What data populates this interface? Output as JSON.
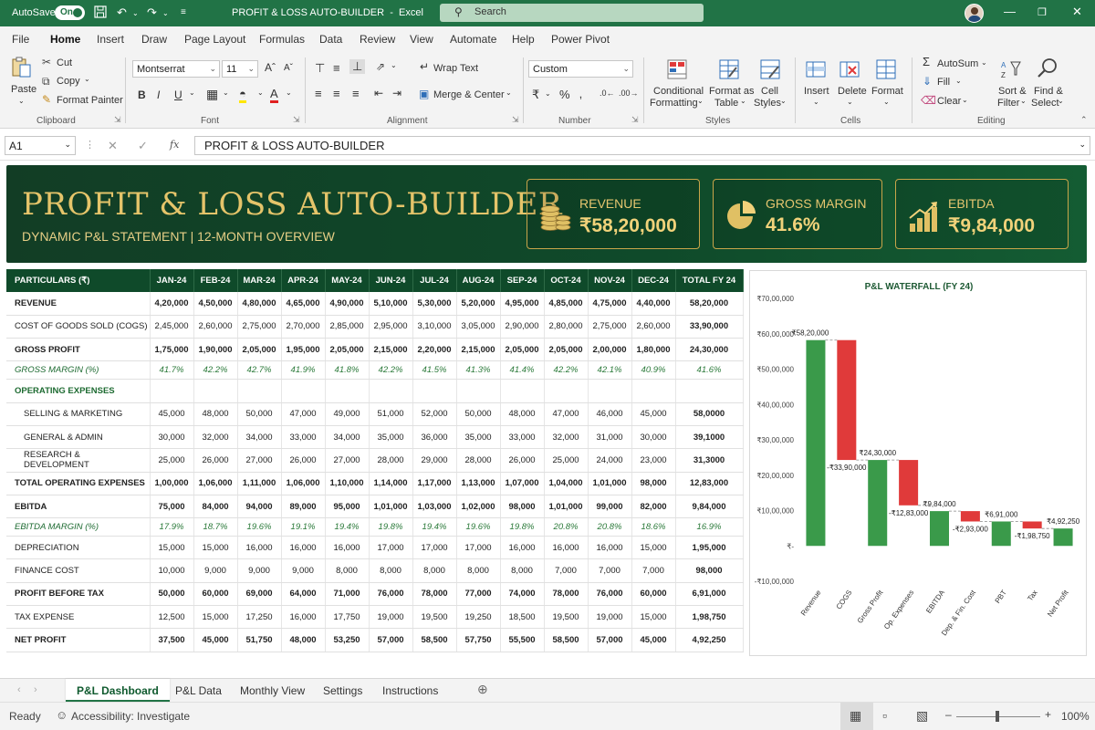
{
  "titlebar": {
    "autosave_label": "AutoSave",
    "autosave_state": "On",
    "doc_title": "PROFIT & LOSS AUTO-BUILDER",
    "separator": "-",
    "app_name": "Excel",
    "search_placeholder": "Search"
  },
  "menu": [
    "File",
    "Home",
    "Insert",
    "Draw",
    "Page Layout",
    "Formulas",
    "Data",
    "Review",
    "View",
    "Automate",
    "Help",
    "Power Pivot"
  ],
  "ribbon": {
    "paste": "Paste",
    "cut": "Cut",
    "copy": "Copy",
    "format_painter": "Format Painter",
    "font_name": "Montserrat",
    "font_size": "11",
    "wrap_text": "Wrap Text",
    "merge_center": "Merge & Center",
    "number_format": "Custom",
    "conditional": "Conditional",
    "formatting": "Formatting",
    "format_as": "Format as",
    "table": "Table",
    "cell": "Cell",
    "styles_btn": "Styles",
    "insert": "Insert",
    "delete": "Delete",
    "format": "Format",
    "autosum": "AutoSum",
    "fill": "Fill",
    "clear": "Clear",
    "sort_filter_1": "Sort &",
    "sort_filter_2": "Filter",
    "find_select_1": "Find &",
    "find_select_2": "Select",
    "groups": {
      "clipboard": "Clipboard",
      "font": "Font",
      "alignment": "Alignment",
      "number": "Number",
      "styles": "Styles",
      "cells": "Cells",
      "editing": "Editing"
    }
  },
  "formula": {
    "cell_ref": "A1",
    "content": "PROFIT & LOSS AUTO-BUILDER"
  },
  "banner": {
    "title": "PROFIT & LOSS AUTO-BUILDER",
    "subtitle": "DYNAMIC P&L STATEMENT  |  12-MONTH OVERVIEW",
    "kpis": [
      {
        "label": "REVENUE",
        "value": "₹58,20,000"
      },
      {
        "label": "GROSS MARGIN",
        "value": "41.6%"
      },
      {
        "label": "EBITDA",
        "value": "₹9,84,000"
      }
    ]
  },
  "table": {
    "headers": [
      "PARTICULARS (₹)",
      "JAN-24",
      "FEB-24",
      "MAR-24",
      "APR-24",
      "MAY-24",
      "JUN-24",
      "JUL-24",
      "AUG-24",
      "SEP-24",
      "OCT-24",
      "NOV-24",
      "DEC-24",
      "TOTAL FY 24"
    ],
    "rows": [
      {
        "style": "bold",
        "cells": [
          "REVENUE",
          "4,20,000",
          "4,50,000",
          "4,80,000",
          "4,65,000",
          "4,90,000",
          "5,10,000",
          "5,30,000",
          "5,20,000",
          "4,95,000",
          "4,85,000",
          "4,75,000",
          "4,40,000",
          "58,20,000"
        ]
      },
      {
        "style": "plain",
        "cells": [
          "COST OF GOODS SOLD (COGS)",
          "2,45,000",
          "2,60,000",
          "2,75,000",
          "2,70,000",
          "2,85,000",
          "2,95,000",
          "3,10,000",
          "3,05,000",
          "2,90,000",
          "2,80,000",
          "2,75,000",
          "2,60,000",
          "33,90,000"
        ]
      },
      {
        "style": "bold",
        "cells": [
          "GROSS PROFIT",
          "1,75,000",
          "1,90,000",
          "2,05,000",
          "1,95,000",
          "2,05,000",
          "2,15,000",
          "2,20,000",
          "2,15,000",
          "2,05,000",
          "2,05,000",
          "2,00,000",
          "1,80,000",
          "24,30,000"
        ]
      },
      {
        "style": "pct",
        "cells": [
          "GROSS MARGIN (%)",
          "41.7%",
          "42.2%",
          "42.7%",
          "41.9%",
          "41.8%",
          "42.2%",
          "41.5%",
          "41.3%",
          "41.4%",
          "42.2%",
          "42.1%",
          "40.9%",
          "41.6%"
        ]
      },
      {
        "style": "section",
        "cells": [
          "OPERATING EXPENSES",
          "",
          "",
          "",
          "",
          "",
          "",
          "",
          "",
          "",
          "",
          "",
          "",
          ""
        ]
      },
      {
        "style": "indent",
        "cells": [
          "SELLING & MARKETING",
          "45,000",
          "48,000",
          "50,000",
          "47,000",
          "49,000",
          "51,000",
          "52,000",
          "50,000",
          "48,000",
          "47,000",
          "46,000",
          "45,000",
          "58,0000"
        ]
      },
      {
        "style": "indent",
        "cells": [
          "GENERAL & ADMIN",
          "30,000",
          "32,000",
          "34,000",
          "33,000",
          "34,000",
          "35,000",
          "36,000",
          "35,000",
          "33,000",
          "32,000",
          "31,000",
          "30,000",
          "39,1000"
        ]
      },
      {
        "style": "indent",
        "cells": [
          "RESEARCH & DEVELOPMENT",
          "25,000",
          "26,000",
          "27,000",
          "26,000",
          "27,000",
          "28,000",
          "29,000",
          "28,000",
          "26,000",
          "25,000",
          "24,000",
          "23,000",
          "31,3000"
        ]
      },
      {
        "style": "bold",
        "cells": [
          "TOTAL OPERATING EXPENSES",
          "1,00,000",
          "1,06,000",
          "1,11,000",
          "1,06,000",
          "1,10,000",
          "1,14,000",
          "1,17,000",
          "1,13,000",
          "1,07,000",
          "1,04,000",
          "1,01,000",
          "98,000",
          "12,83,000"
        ]
      },
      {
        "style": "bold",
        "cells": [
          "EBITDA",
          "75,000",
          "84,000",
          "94,000",
          "89,000",
          "95,000",
          "1,01,000",
          "1,03,000",
          "1,02,000",
          "98,000",
          "1,01,000",
          "99,000",
          "82,000",
          "9,84,000"
        ]
      },
      {
        "style": "pct",
        "cells": [
          "EBITDA MARGIN (%)",
          "17.9%",
          "18.7%",
          "19.6%",
          "19.1%",
          "19.4%",
          "19.8%",
          "19.4%",
          "19.6%",
          "19.8%",
          "20.8%",
          "20.8%",
          "18.6%",
          "16.9%"
        ]
      },
      {
        "style": "plain",
        "cells": [
          "DEPRECIATION",
          "15,000",
          "15,000",
          "16,000",
          "16,000",
          "16,000",
          "17,000",
          "17,000",
          "17,000",
          "16,000",
          "16,000",
          "16,000",
          "15,000",
          "1,95,000"
        ]
      },
      {
        "style": "plain",
        "cells": [
          "FINANCE COST",
          "10,000",
          "9,000",
          "9,000",
          "9,000",
          "8,000",
          "8,000",
          "8,000",
          "8,000",
          "8,000",
          "7,000",
          "7,000",
          "7,000",
          "98,000"
        ]
      },
      {
        "style": "bold",
        "cells": [
          "PROFIT BEFORE TAX",
          "50,000",
          "60,000",
          "69,000",
          "64,000",
          "71,000",
          "76,000",
          "78,000",
          "77,000",
          "74,000",
          "78,000",
          "76,000",
          "60,000",
          "6,91,000"
        ]
      },
      {
        "style": "plain",
        "cells": [
          "TAX EXPENSE",
          "12,500",
          "15,000",
          "17,250",
          "16,000",
          "17,750",
          "19,000",
          "19,500",
          "19,250",
          "18,500",
          "19,500",
          "19,000",
          "15,000",
          "1,98,750"
        ]
      },
      {
        "style": "bold",
        "cells": [
          "NET PROFIT",
          "37,500",
          "45,000",
          "51,750",
          "48,000",
          "53,250",
          "57,000",
          "58,500",
          "57,750",
          "55,500",
          "58,500",
          "57,000",
          "45,000",
          "4,92,250"
        ]
      }
    ]
  },
  "chart_data": {
    "type": "bar",
    "subtype": "waterfall",
    "title": "P&L WATERFALL (FY 24)",
    "categories": [
      "Revenue",
      "COGS",
      "Gross Profit",
      "Op. Expenses",
      "EBITDA",
      "Dep. & Fin. Cost",
      "PBT",
      "Tax",
      "Net Profit"
    ],
    "values": [
      5820000,
      -3390000,
      2430000,
      -1283000,
      984000,
      -293000,
      691000,
      -198750,
      492250
    ],
    "kinds": [
      "total",
      "delta",
      "total",
      "delta",
      "total",
      "delta",
      "total",
      "delta",
      "total"
    ],
    "data_labels": [
      "₹58,20,000",
      "-₹33,90,000",
      "₹24,30,000",
      "-₹12,83,000",
      "₹9,84,000",
      "-₹2,93,000",
      "₹6,91,000",
      "-₹1,98,750",
      "₹4,92,250"
    ],
    "yticks": [
      -1000000,
      0,
      1000000,
      2000000,
      3000000,
      4000000,
      5000000,
      6000000,
      7000000
    ],
    "ytick_labels": [
      "-₹10,00,000",
      "₹-",
      "₹10,00,000",
      "₹20,00,000",
      "₹30,00,000",
      "₹40,00,000",
      "₹50,00,000",
      "₹60,00,000",
      "₹70,00,000"
    ],
    "ylim": [
      -1000000,
      7000000
    ],
    "colors": {
      "total": "#3a9a4a",
      "delta": "#e03a3a",
      "connector": "#888888"
    },
    "grid": false
  },
  "sheets": [
    "P&L Dashboard",
    "P&L Data",
    "Monthly View",
    "Settings",
    "Instructions"
  ],
  "status": {
    "ready": "Ready",
    "accessibility": "Accessibility: Investigate",
    "zoom": "100%"
  }
}
